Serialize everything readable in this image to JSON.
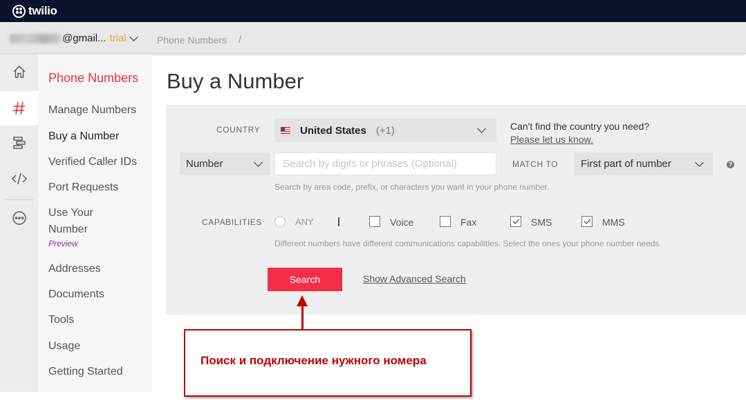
{
  "brand": {
    "logo_text": "twilio",
    "accent_color": "#f22f46",
    "nav_bg": "#0d122b"
  },
  "account": {
    "email_visible": "@gmail...",
    "plan": "trial"
  },
  "breadcrumb": {
    "section": "Phone Numbers",
    "separator": "/"
  },
  "rail": {
    "items": [
      {
        "icon": "home-icon"
      },
      {
        "icon": "hash-icon",
        "active": true
      },
      {
        "icon": "flow-icon"
      },
      {
        "icon": "code-icon"
      },
      {
        "icon": "more-icon"
      }
    ]
  },
  "sidebar": {
    "title": "Phone Numbers",
    "items": [
      {
        "label": "Manage Numbers"
      },
      {
        "label": "Buy a Number",
        "current": true
      },
      {
        "label": "Verified Caller IDs"
      },
      {
        "label": "Port Requests"
      },
      {
        "label_line1": "Use Your",
        "label_line2": "Number",
        "badge": "Preview"
      },
      {
        "label": "Addresses"
      },
      {
        "label": "Documents"
      },
      {
        "label": "Tools"
      },
      {
        "label": "Usage"
      },
      {
        "label": "Getting Started"
      }
    ]
  },
  "page": {
    "title": "Buy a Number"
  },
  "form": {
    "country_label": "COUNTRY",
    "country_name": "United States",
    "country_code": "(+1)",
    "country_help": "Can't find the country you need?",
    "country_help_link": "Please let us know.",
    "search_type": "Number",
    "search_placeholder": "Search by digits or phrases (Optional)",
    "match_label": "MATCH TO",
    "match_value": "First part of number",
    "search_hint": "Search by area code, prefix, or characters you want in your phone number.",
    "capabilities_label": "CAPABILITIES",
    "capabilities": {
      "any": {
        "label": "ANY",
        "checked": false
      },
      "voice": {
        "label": "Voice",
        "checked": false
      },
      "fax": {
        "label": "Fax",
        "checked": false
      },
      "sms": {
        "label": "SMS",
        "checked": true
      },
      "mms": {
        "label": "MMS",
        "checked": true
      }
    },
    "capabilities_hint": "Different numbers have different communications capabilities. Select the ones your phone number needs.",
    "search_button": "Search",
    "advanced_link": "Show Advanced Search"
  },
  "annotation": {
    "text": "Поиск и подключение нужного номера",
    "color": "#c00000"
  }
}
